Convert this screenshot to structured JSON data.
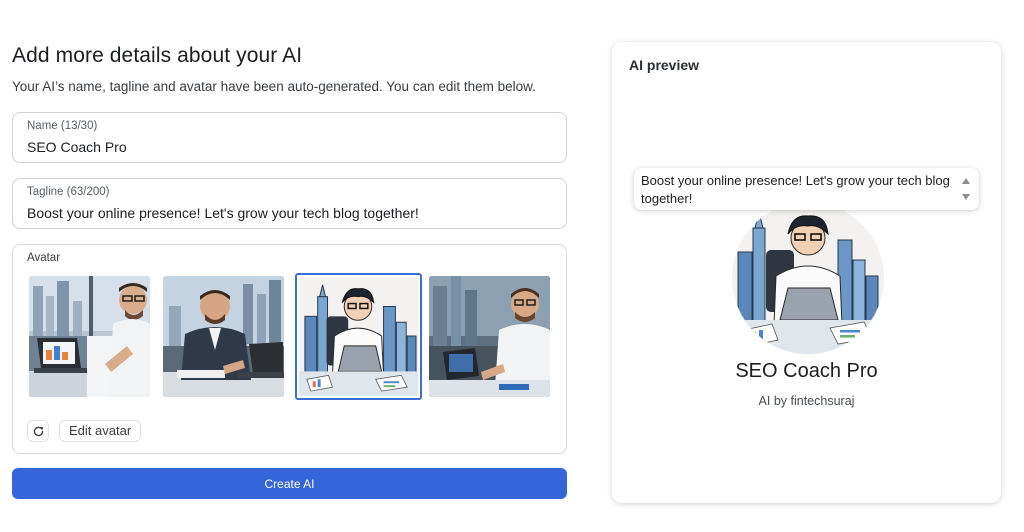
{
  "page": {
    "heading": "Add more details about your AI",
    "subheading": "Your AI’s name, tagline and avatar have been auto-generated. You can edit them below."
  },
  "form": {
    "name": {
      "label": "Name (13/30)",
      "value": "SEO Coach Pro"
    },
    "tagline": {
      "label": "Tagline (63/200)",
      "value": "Boost your online presence! Let's grow your tech blog together!"
    },
    "avatar": {
      "label": "Avatar",
      "selected_index": 2,
      "options": [
        "photo-man-laptop-charts",
        "photo-man-suit-laptop",
        "illustration-man-laptop-city",
        "photo-man-office-laptop"
      ],
      "edit_label": "Edit avatar",
      "regenerate_icon": "refresh-icon"
    },
    "submit_label": "Create AI"
  },
  "preview": {
    "title": "AI preview",
    "tagline": "Boost your online presence! Let's grow your tech blog together!",
    "name": "SEO Coach Pro",
    "author": "AI by fintechsuraj"
  },
  "colors": {
    "accent": "#3466d9",
    "selected_border": "#3b6fd6"
  }
}
